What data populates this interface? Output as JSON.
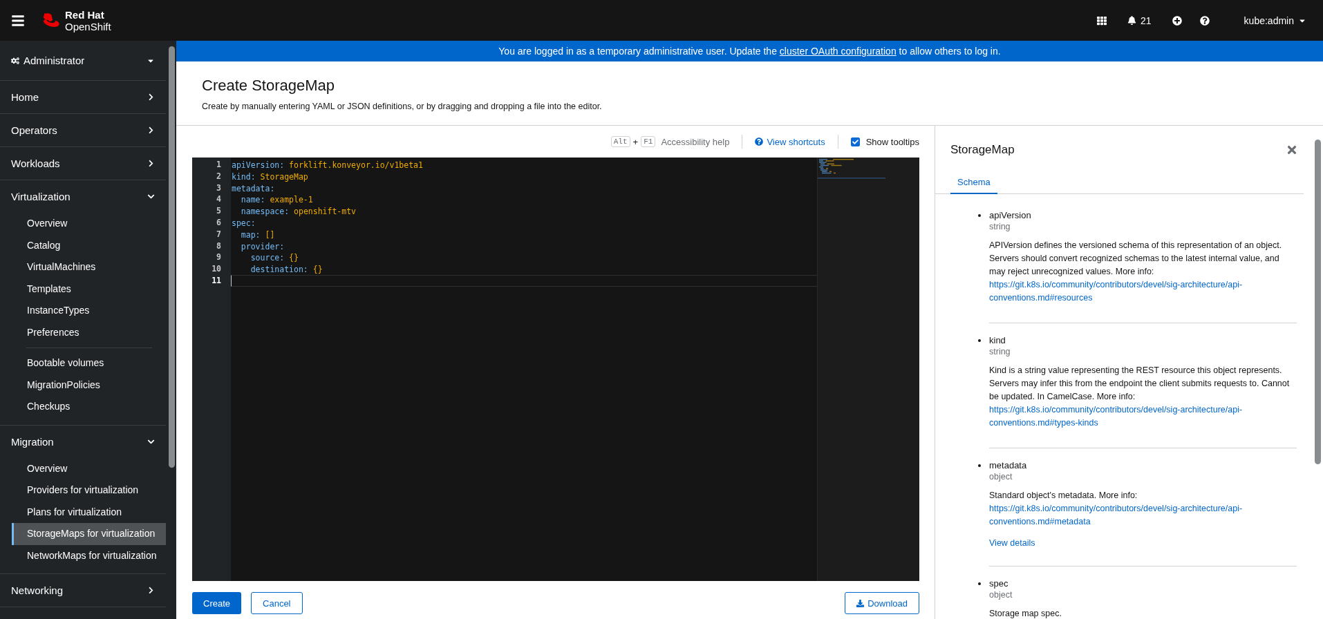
{
  "masthead": {
    "brand_top": "Red Hat",
    "brand_bottom": "OpenShift",
    "notifications": "21",
    "user": "kube:admin"
  },
  "perspective": "Administrator",
  "nav": [
    {
      "label": "Home",
      "expanded": false
    },
    {
      "label": "Operators",
      "expanded": false
    },
    {
      "label": "Workloads",
      "expanded": false
    },
    {
      "label": "Virtualization",
      "expanded": true,
      "groups": [
        {
          "items": [
            {
              "label": "Overview",
              "selected": false
            },
            {
              "label": "Catalog",
              "selected": false
            },
            {
              "label": "VirtualMachines",
              "selected": false
            },
            {
              "label": "Templates",
              "selected": false
            },
            {
              "label": "InstanceTypes",
              "selected": false
            },
            {
              "label": "Preferences",
              "selected": false
            }
          ]
        },
        {
          "items": [
            {
              "label": "Bootable volumes",
              "selected": false
            },
            {
              "label": "MigrationPolicies",
              "selected": false
            },
            {
              "label": "Checkups",
              "selected": false
            }
          ]
        }
      ]
    },
    {
      "label": "Migration",
      "expanded": true,
      "groups": [
        {
          "items": [
            {
              "label": "Overview",
              "selected": false
            },
            {
              "label": "Providers for virtualization",
              "selected": false
            },
            {
              "label": "Plans for virtualization",
              "selected": false
            },
            {
              "label": "StorageMaps for virtualization",
              "selected": true
            },
            {
              "label": "NetworkMaps for virtualization",
              "selected": false
            }
          ]
        }
      ]
    },
    {
      "label": "Networking",
      "expanded": false
    }
  ],
  "banner": {
    "before": "You are logged in as a temporary administrative user. Update the ",
    "link": "cluster OAuth configuration",
    "after": " to allow others to log in."
  },
  "page": {
    "title": "Create StorageMap",
    "description": "Create by manually entering YAML or JSON definitions, or by dragging and dropping a file into the editor."
  },
  "editor_toolbar": {
    "keys": [
      "Alt",
      "F1"
    ],
    "plus": "+",
    "accessibility_help": "Accessibility help",
    "view_shortcuts": "View shortcuts",
    "show_tooltips": {
      "label": "Show tooltips",
      "checked": true
    }
  },
  "code": [
    {
      "number": "1",
      "key": "apiVersion:",
      "value": "forklift.konveyor.io/v1beta1",
      "current": false
    },
    {
      "number": "2",
      "key": "kind:",
      "value": "StorageMap",
      "current": false
    },
    {
      "number": "3",
      "key": "metadata:",
      "current": false
    },
    {
      "number": "4",
      "key": "  name:",
      "value": "example-1",
      "current": false
    },
    {
      "number": "5",
      "key": "  namespace:",
      "value": "openshift-mtv",
      "current": false
    },
    {
      "number": "6",
      "key": "spec:",
      "current": false
    },
    {
      "number": "7",
      "key": "  map:",
      "value": "[]",
      "current": false
    },
    {
      "number": "8",
      "key": "  provider:",
      "current": false
    },
    {
      "number": "9",
      "key": "    source:",
      "value": "{}",
      "current": false
    },
    {
      "number": "10",
      "key": "    destination:",
      "value": "{}",
      "current": false
    },
    {
      "number": "11",
      "current": true
    }
  ],
  "actions": {
    "create": "Create",
    "cancel": "Cancel",
    "download": "Download"
  },
  "schema_panel": {
    "title": "StorageMap",
    "tabs": [
      {
        "label": "Schema",
        "selected": true
      }
    ],
    "fields": [
      {
        "name": "apiVersion",
        "type": "string",
        "description": "APIVersion defines the versioned schema of this representation of an object. Servers should convert recognized schemas to the latest internal value, and may reject unrecognized values. More info:",
        "link": "https://git.k8s.io/community/contributors/devel/sig-architecture/api-conventions.md#resources"
      },
      {
        "name": "kind",
        "type": "string",
        "description": "Kind is a string value representing the REST resource this object represents. Servers may infer this from the endpoint the client submits requests to. Cannot be updated. In CamelCase. More info:",
        "link": "https://git.k8s.io/community/contributors/devel/sig-architecture/api-conventions.md#types-kinds"
      },
      {
        "name": "metadata",
        "type": "object",
        "description": "Standard object's metadata. More info:",
        "link": "https://git.k8s.io/community/contributors/devel/sig-architecture/api-conventions.md#metadata",
        "details": "View details"
      },
      {
        "name": "spec",
        "type": "object",
        "description": "Storage map spec."
      }
    ]
  }
}
